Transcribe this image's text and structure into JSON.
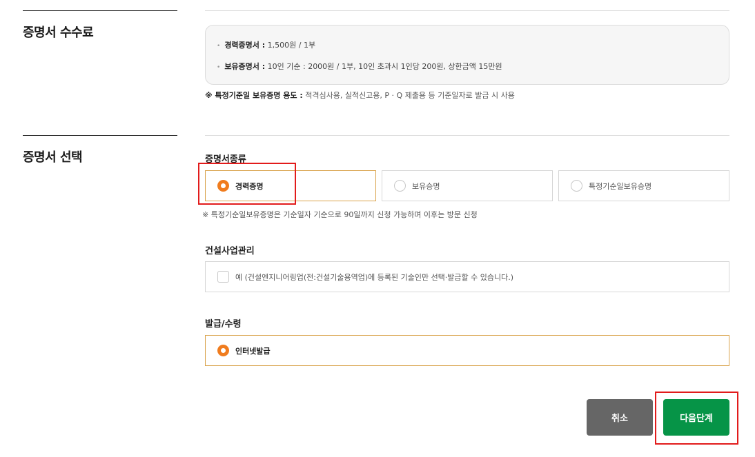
{
  "fee_section": {
    "title": "증명서 수수료",
    "items": [
      {
        "bold": "경력증명서 :",
        "text": " 1,500원 / 1부"
      },
      {
        "bold": "보유증명서 :",
        "text": " 10인 기순 : 2000원 / 1부, 10인 초과시 1인당 200원, 상한금액 15만원"
      }
    ],
    "note_bold": "※ 특정기준일 보유증명 용도 :",
    "note_text": " 적격심사용, 실적신고용, P · Q 제출용 등 기준일자로 발급 시 사용"
  },
  "select_section": {
    "title": "증명서 선택",
    "cert_type": {
      "label": "증명서종류",
      "options": [
        {
          "label": "경력증명",
          "selected": true
        },
        {
          "label": "보유승명",
          "selected": false
        },
        {
          "label": "특정기순일보유승명",
          "selected": false
        }
      ],
      "note": "※ 특정기순일보유증명은 기순일자 기순으로 90일까지 신청 가능하며 이후는 방문 신청"
    },
    "construction": {
      "label": "건설사업관리",
      "checkbox_label": "예 (건설엔지니어링업(전:건설기술용역업)에 등록된 기술인만 선택·발급할 수 있습니다.)",
      "checked": false
    },
    "delivery": {
      "label": "발급/수령",
      "option": {
        "label": "인터넷발급",
        "selected": true
      }
    }
  },
  "buttons": {
    "cancel": "취소",
    "next": "다음단계"
  },
  "colors": {
    "accent_orange": "#f07c1e",
    "selected_border": "#d9a24a",
    "next_green": "#069447",
    "cancel_gray": "#666666",
    "highlight_red": "#e21b1b"
  }
}
